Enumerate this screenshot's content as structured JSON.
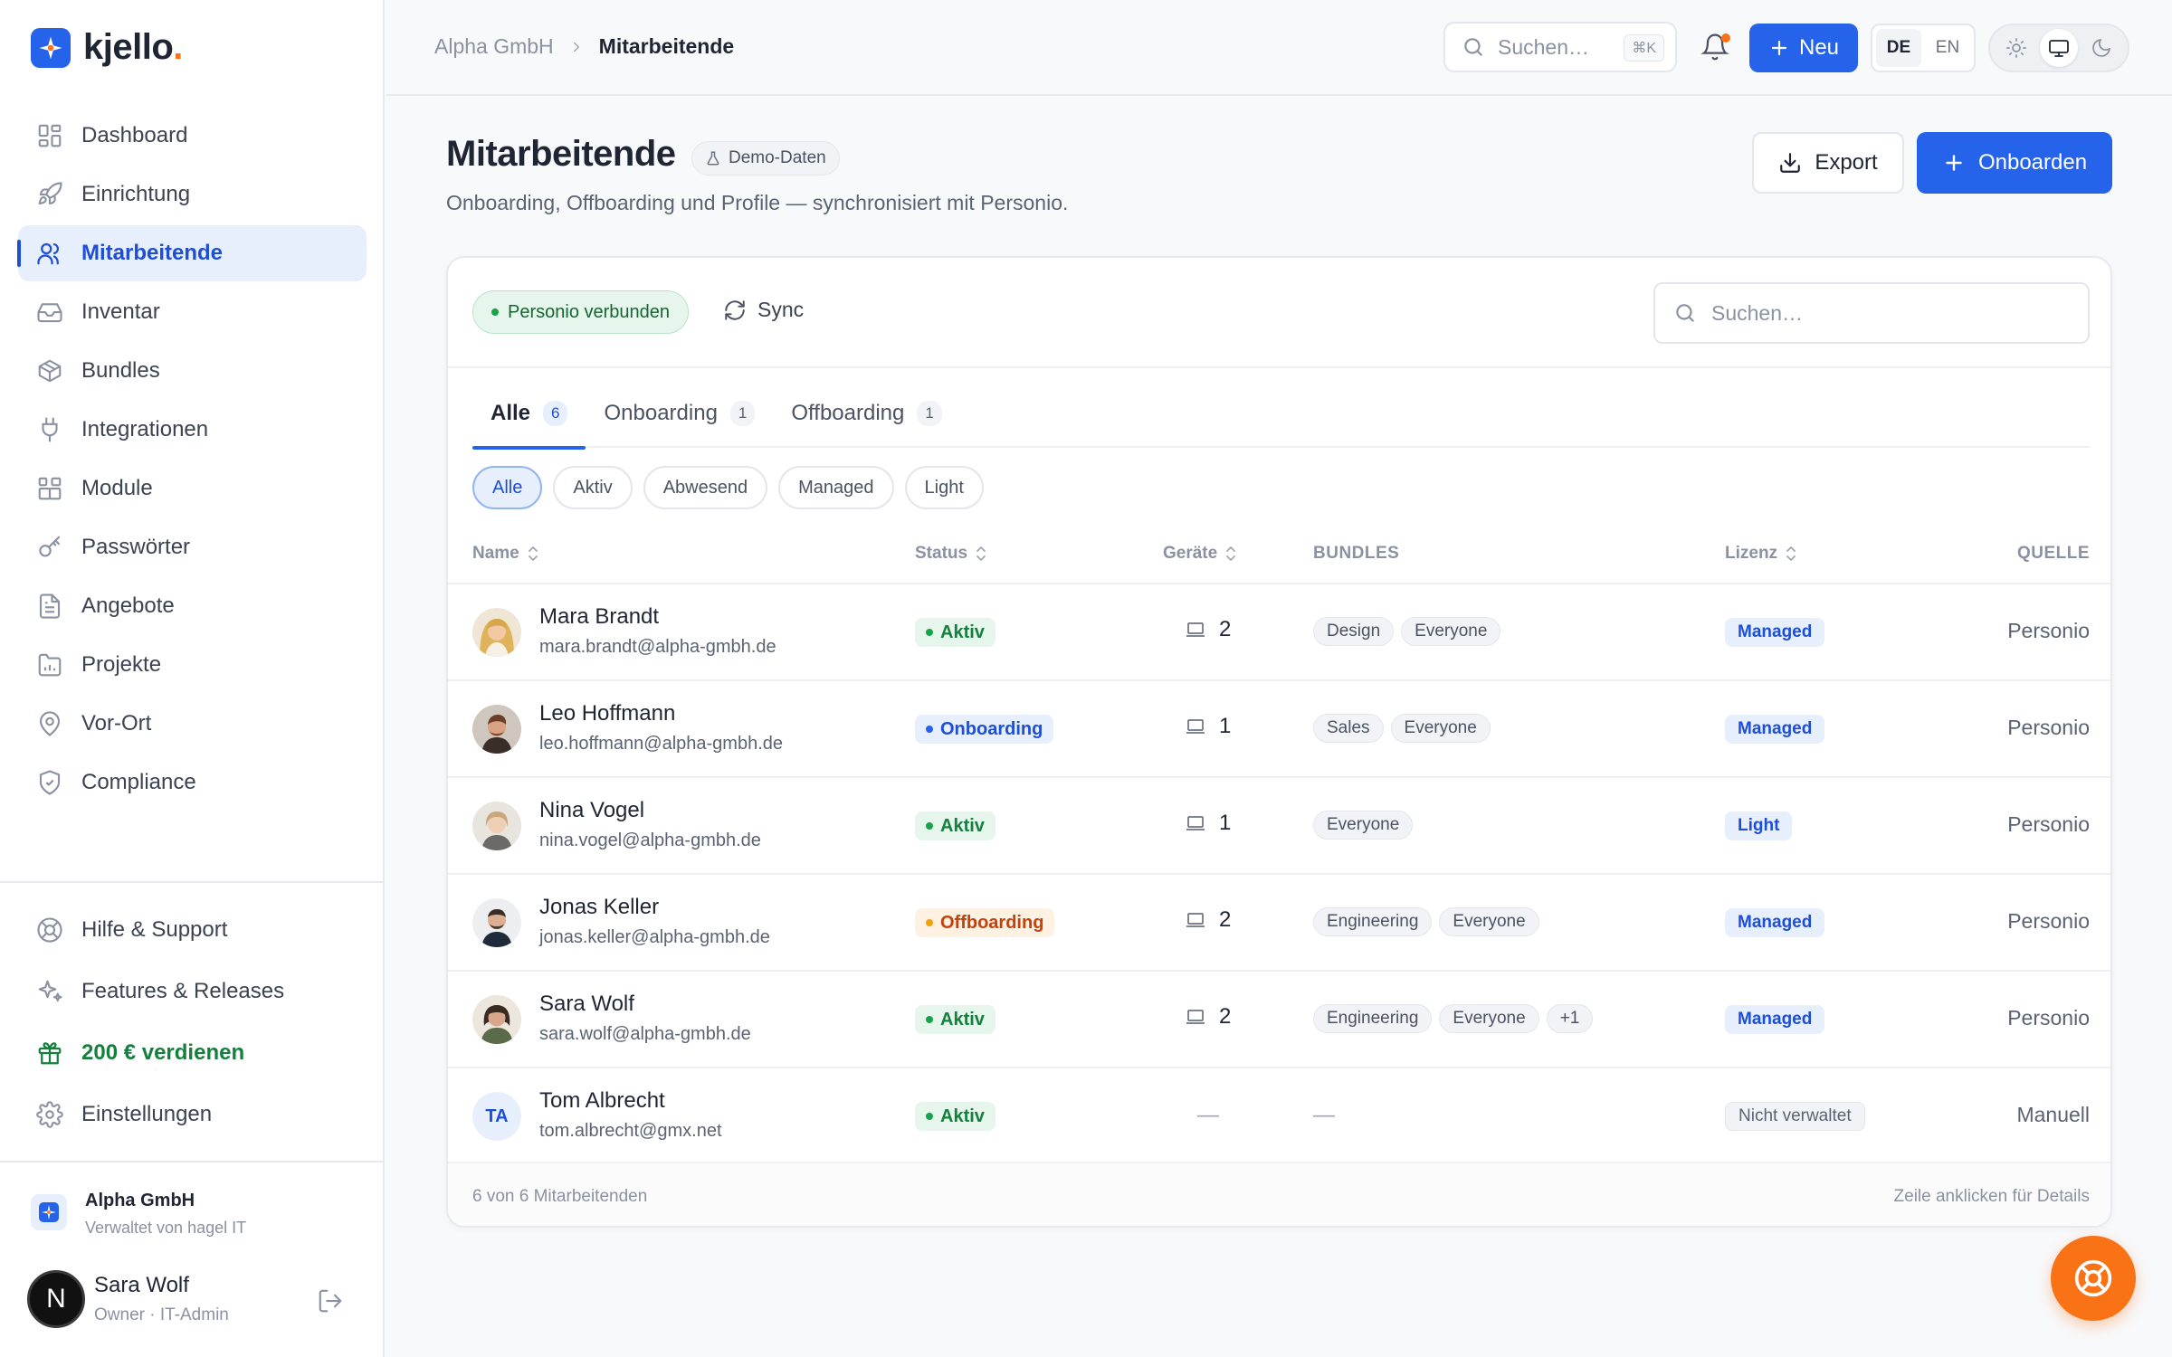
{
  "app": {
    "name": "kjello",
    "brand_color": "#2563eb",
    "accent_color": "#f97316"
  },
  "sidebar": {
    "items": [
      {
        "label": "Dashboard",
        "icon": "dashboard-icon"
      },
      {
        "label": "Einrichtung",
        "icon": "rocket-icon"
      },
      {
        "label": "Mitarbeitende",
        "icon": "users-icon",
        "active": true
      },
      {
        "label": "Inventar",
        "icon": "inbox-icon"
      },
      {
        "label": "Bundles",
        "icon": "package-icon"
      },
      {
        "label": "Integrationen",
        "icon": "plug-icon"
      },
      {
        "label": "Module",
        "icon": "modules-icon"
      },
      {
        "label": "Passwörter",
        "icon": "key-icon"
      },
      {
        "label": "Angebote",
        "icon": "document-icon"
      },
      {
        "label": "Projekte",
        "icon": "folder-chart-icon"
      },
      {
        "label": "Vor-Ort",
        "icon": "map-pin-icon"
      },
      {
        "label": "Compliance",
        "icon": "shield-check-icon"
      }
    ],
    "bottom_items": [
      {
        "label": "Hilfe & Support",
        "icon": "lifebuoy-icon"
      },
      {
        "label": "Features & Releases",
        "icon": "sparkles-icon"
      },
      {
        "label": "200 € verdienen",
        "icon": "gift-icon"
      },
      {
        "label": "Einstellungen",
        "icon": "gear-icon"
      }
    ],
    "org": {
      "name": "Alpha GmbH",
      "subtitle": "Verwaltet von hagel IT"
    },
    "user": {
      "name": "Sara Wolf",
      "role": "Owner · IT-Admin",
      "initial": "N"
    }
  },
  "topbar": {
    "breadcrumb_parent": "Alpha GmbH",
    "breadcrumb_current": "Mitarbeitende",
    "search_placeholder": "Suchen…",
    "search_shortcut": "⌘K",
    "new_button": "Neu",
    "languages": [
      "DE",
      "EN"
    ],
    "active_language": "DE",
    "theme_active": "system"
  },
  "page": {
    "title": "Mitarbeitende",
    "badge": "Demo-Daten",
    "subtitle": "Onboarding, Offboarding und Profile — synchronisiert mit Personio.",
    "export_button": "Export",
    "onboard_button": "Onboarden"
  },
  "card": {
    "connection_status": "Personio verbunden",
    "sync_label": "Sync",
    "search_placeholder": "Suchen…",
    "tabs": [
      {
        "label": "Alle",
        "count": "6",
        "active": true
      },
      {
        "label": "Onboarding",
        "count": "1"
      },
      {
        "label": "Offboarding",
        "count": "1"
      }
    ],
    "filters": [
      {
        "label": "Alle",
        "active": true
      },
      {
        "label": "Aktiv"
      },
      {
        "label": "Abwesend"
      },
      {
        "label": "Managed"
      },
      {
        "label": "Light"
      }
    ],
    "columns": {
      "name": "Name",
      "status": "Status",
      "devices": "Geräte",
      "bundles": "BUNDLES",
      "license": "Lizenz",
      "source": "QUELLE"
    },
    "rows": [
      {
        "name": "Mara Brandt",
        "email": "mara.brandt@alpha-gmbh.de",
        "status": "Aktiv",
        "status_kind": "aktiv",
        "devices": "2",
        "bundles": [
          "Design",
          "Everyone"
        ],
        "license": "Managed",
        "source": "Personio"
      },
      {
        "name": "Leo Hoffmann",
        "email": "leo.hoffmann@alpha-gmbh.de",
        "status": "Onboarding",
        "status_kind": "onboarding",
        "devices": "1",
        "bundles": [
          "Sales",
          "Everyone"
        ],
        "license": "Managed",
        "source": "Personio"
      },
      {
        "name": "Nina Vogel",
        "email": "nina.vogel@alpha-gmbh.de",
        "status": "Aktiv",
        "status_kind": "aktiv",
        "devices": "1",
        "bundles": [
          "Everyone"
        ],
        "license": "Light",
        "source": "Personio"
      },
      {
        "name": "Jonas Keller",
        "email": "jonas.keller@alpha-gmbh.de",
        "status": "Offboarding",
        "status_kind": "offboarding",
        "devices": "2",
        "bundles": [
          "Engineering",
          "Everyone"
        ],
        "license": "Managed",
        "source": "Personio"
      },
      {
        "name": "Sara Wolf",
        "email": "sara.wolf@alpha-gmbh.de",
        "status": "Aktiv",
        "status_kind": "aktiv",
        "devices": "2",
        "bundles": [
          "Engineering",
          "Everyone",
          "+1"
        ],
        "license": "Managed",
        "source": "Personio"
      },
      {
        "name": "Tom Albrecht",
        "email": "tom.albrecht@gmx.net",
        "initials": "TA",
        "status": "Aktiv",
        "status_kind": "aktiv",
        "devices": "—",
        "bundles_empty": "—",
        "license": "Nicht verwaltet",
        "source": "Manuell"
      }
    ],
    "footer_left": "6 von 6 Mitarbeitenden",
    "footer_right": "Zeile anklicken für Details"
  }
}
